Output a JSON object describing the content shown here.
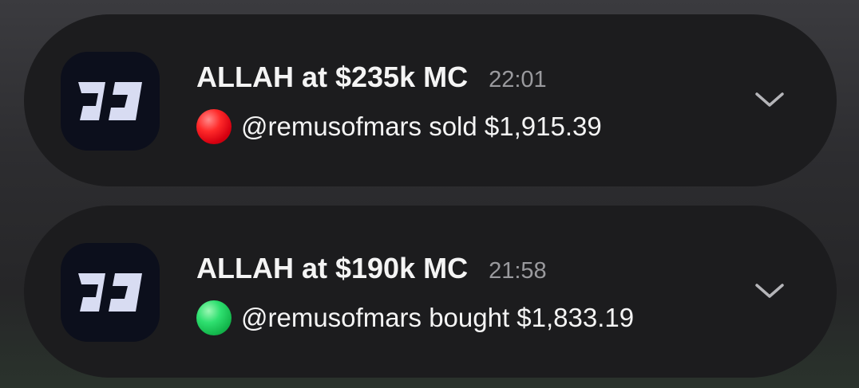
{
  "notifications": [
    {
      "title": "ALLAH at $235k MC",
      "time": "22:01",
      "status": "sold",
      "status_color": "#e8101e",
      "message": "@remusofmars sold $1,915.39",
      "icon": "app-logo-icon",
      "expand_icon": "chevron-down-icon"
    },
    {
      "title": "ALLAH at $190k MC",
      "time": "21:58",
      "status": "bought",
      "status_color": "#22c55e",
      "message": "@remusofmars bought $1,833.19",
      "icon": "app-logo-icon",
      "expand_icon": "chevron-down-icon"
    }
  ],
  "colors": {
    "card_background": "#1c1c1e",
    "icon_background": "#0c0f1c",
    "primary_text": "#f4f4f4",
    "secondary_text": "#9a9a9e"
  }
}
